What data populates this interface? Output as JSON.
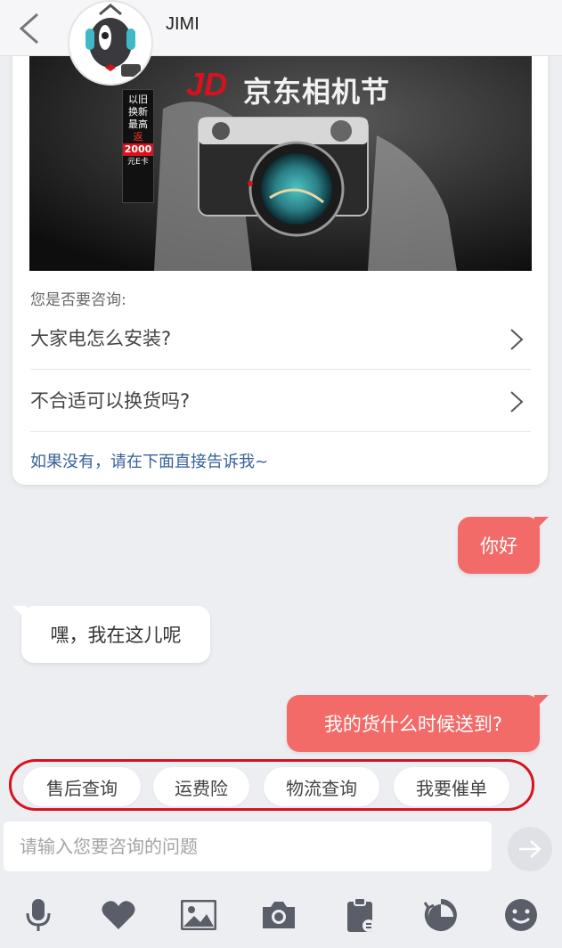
{
  "header": {
    "title": "JIMI"
  },
  "card": {
    "banner": {
      "brand": "JD",
      "event": "京东相机节",
      "side_tag": [
        "以旧",
        "换新",
        "最高",
        "返",
        "2000",
        "元E卡"
      ]
    },
    "consult_label": "您是否要咨询:",
    "faq": [
      {
        "label": "大家电怎么安装?"
      },
      {
        "label": "不合适可以换货吗?"
      }
    ],
    "hint": "如果没有，请在下面直接告诉我~"
  },
  "messages": [
    {
      "from": "user",
      "text": "你好"
    },
    {
      "from": "bot",
      "text": "嘿，我在这儿呢"
    },
    {
      "from": "user",
      "text": "我的货什么时候送到?"
    }
  ],
  "quick_replies": [
    "售后查询",
    "运费险",
    "物流查询",
    "我要催单"
  ],
  "input": {
    "placeholder": "请输入您要咨询的问题"
  },
  "toolbar": [
    "microphone-icon",
    "heart-icon",
    "image-icon",
    "camera-icon",
    "clipboard-icon",
    "history-icon",
    "emoji-icon"
  ],
  "colors": {
    "accent": "#f36b68",
    "highlight_ring": "#d8121d",
    "link": "#36609a",
    "background": "#eceef2"
  }
}
